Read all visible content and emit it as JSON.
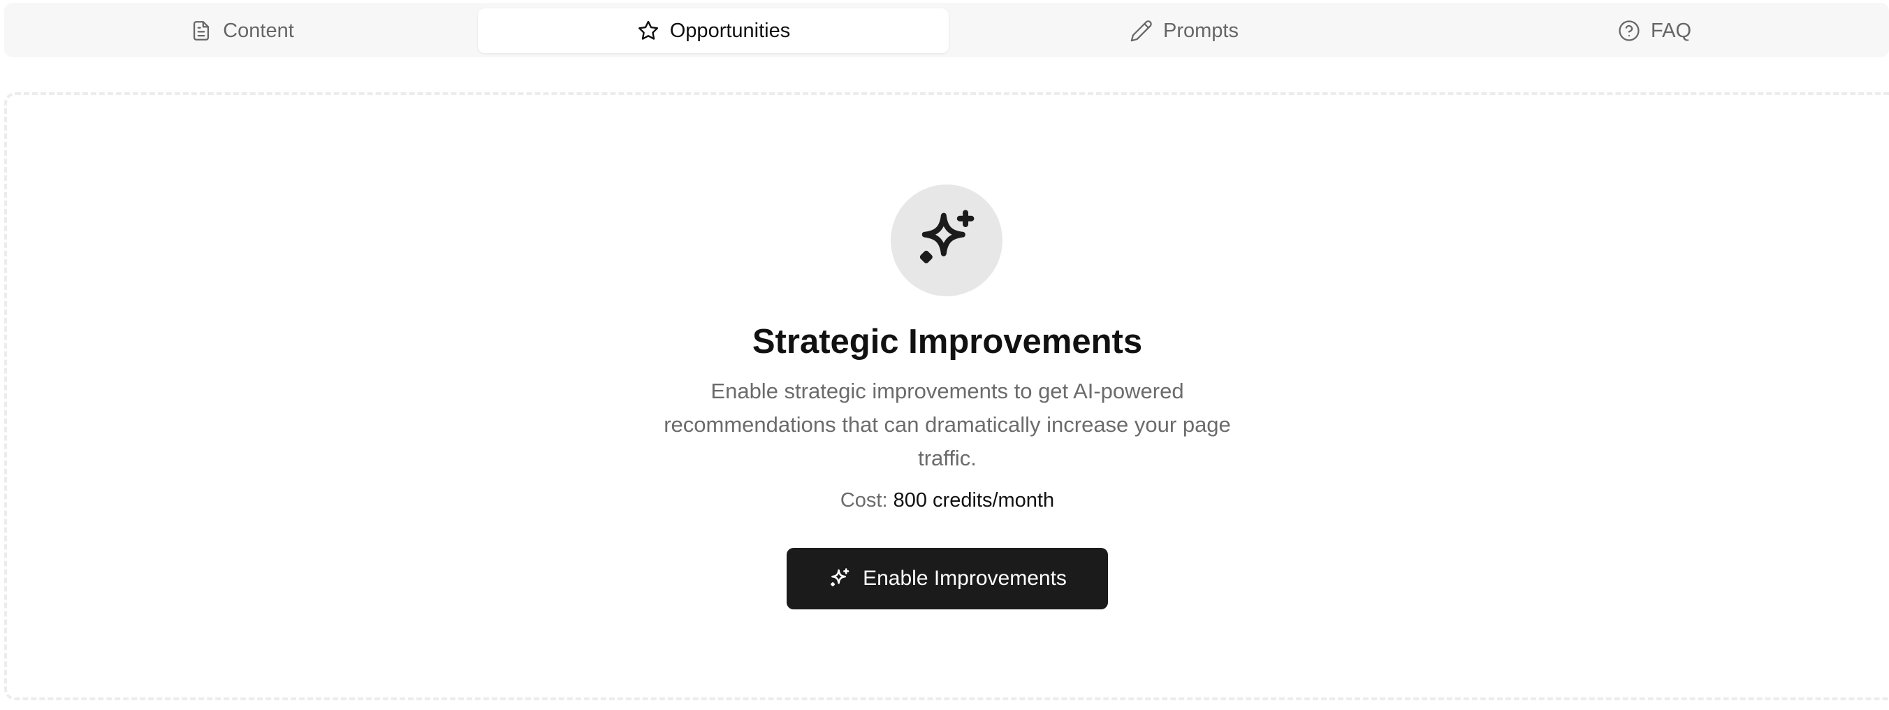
{
  "tabs": [
    {
      "label": "Content",
      "icon": "file-text-icon",
      "active": false
    },
    {
      "label": "Opportunities",
      "icon": "star-icon",
      "active": true
    },
    {
      "label": "Prompts",
      "icon": "pencil-icon",
      "active": false
    },
    {
      "label": "FAQ",
      "icon": "help-circle-icon",
      "active": false
    }
  ],
  "main": {
    "icon": "sparkles-icon",
    "title": "Strategic Improvements",
    "description": "Enable strategic improvements to get AI-powered recommendations that can dramatically increase your page traffic.",
    "cost_label": "Cost:",
    "cost_value": "800 credits/month",
    "cta_label": "Enable Improvements",
    "cta_icon": "sparkles-icon"
  },
  "colors": {
    "tabbar_bg": "#f7f7f7",
    "active_tab_bg": "#ffffff",
    "icon_circle_bg": "#e7e7e7",
    "cta_bg": "#1b1b1b",
    "muted_text": "#6b6b6b"
  }
}
